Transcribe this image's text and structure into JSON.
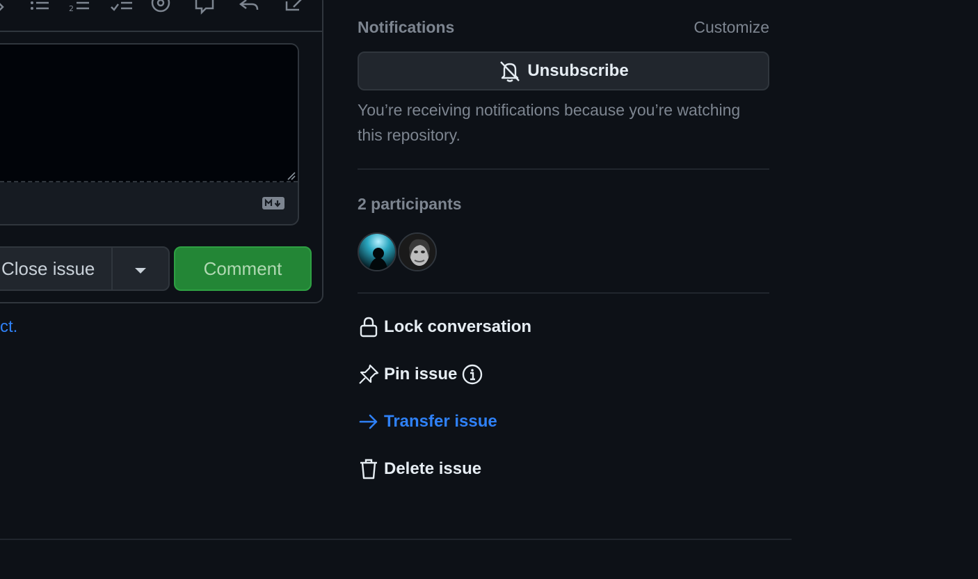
{
  "editor": {
    "textarea_value": "",
    "close_issue_label": "Close issue",
    "comment_label": "Comment",
    "tos_link_tail": "ct."
  },
  "toolbar_icons": [
    "edit-icon",
    "unordered-list-icon",
    "ordered-list-icon",
    "task-list-icon",
    "mention-icon",
    "cross-reference-icon",
    "reply-icon",
    "edit-square-icon"
  ],
  "notifications": {
    "title": "Notifications",
    "customize_label": "Customize",
    "unsubscribe_label": "Unsubscribe",
    "reason": "You’re receiving notifications because you’re watching this repository."
  },
  "participants": {
    "title": "2 participants",
    "avatars": [
      "avatar-participant-1",
      "avatar-participant-2"
    ]
  },
  "actions": {
    "lock": "Lock conversation",
    "pin": "Pin issue",
    "transfer": "Transfer issue",
    "delete": "Delete issue"
  },
  "colors": {
    "background": "#0d1117",
    "border": "#30363d",
    "muted_text": "#7d8590",
    "link": "#2f81f7",
    "primary_button": "#238636"
  }
}
